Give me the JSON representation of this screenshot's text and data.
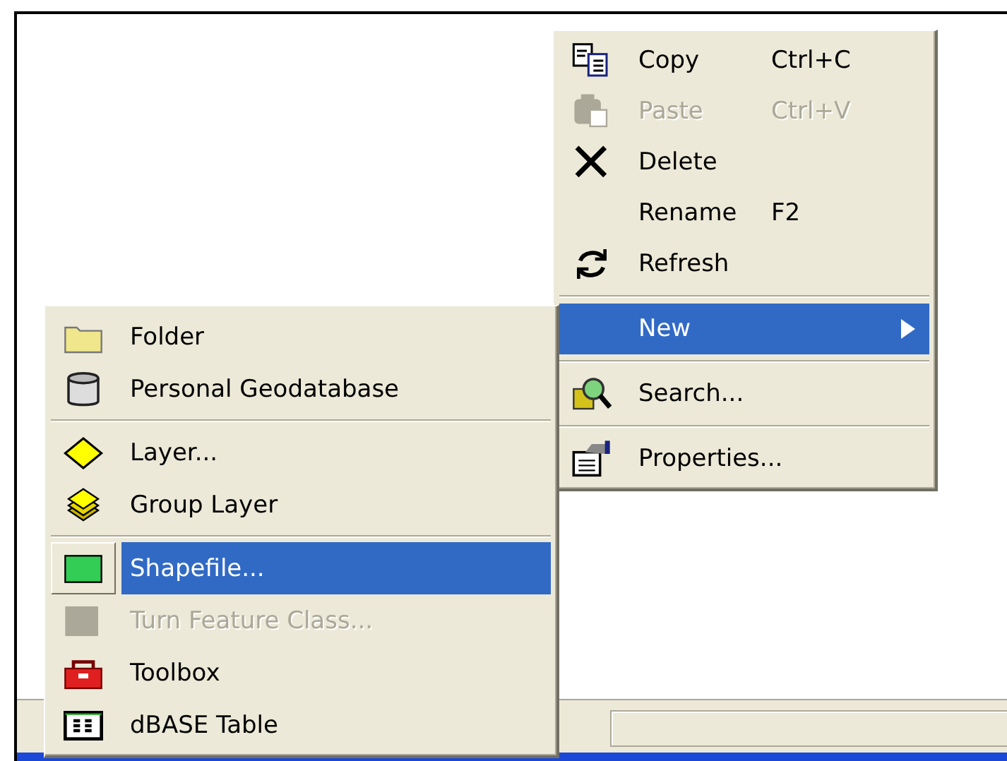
{
  "context_menu": {
    "items": [
      {
        "kind": "item",
        "label": "Copy",
        "shortcut": "Ctrl+C",
        "disabled": false,
        "selected": false,
        "has_submenu": false
      },
      {
        "kind": "item",
        "label": "Paste",
        "shortcut": "Ctrl+V",
        "disabled": true,
        "selected": false,
        "has_submenu": false
      },
      {
        "kind": "item",
        "label": "Delete",
        "disabled": false,
        "selected": false,
        "has_submenu": false
      },
      {
        "kind": "item",
        "label": "Rename",
        "shortcut": "F2",
        "disabled": false,
        "selected": false,
        "has_submenu": false
      },
      {
        "kind": "item",
        "label": "Refresh",
        "disabled": false,
        "selected": false,
        "has_submenu": false
      },
      {
        "kind": "separator"
      },
      {
        "kind": "item",
        "label": "New",
        "disabled": false,
        "selected": true,
        "has_submenu": true
      },
      {
        "kind": "separator"
      },
      {
        "kind": "item",
        "label": "Search...",
        "disabled": false,
        "selected": false,
        "has_submenu": false
      },
      {
        "kind": "separator"
      },
      {
        "kind": "item",
        "label": "Properties...",
        "disabled": false,
        "selected": false,
        "has_submenu": false
      }
    ]
  },
  "submenu": {
    "items": [
      {
        "kind": "item",
        "label": "Folder",
        "disabled": false,
        "selected": false
      },
      {
        "kind": "item",
        "label": "Personal Geodatabase",
        "disabled": false,
        "selected": false
      },
      {
        "kind": "separator"
      },
      {
        "kind": "item",
        "label": "Layer...",
        "disabled": false,
        "selected": false
      },
      {
        "kind": "item",
        "label": "Group Layer",
        "disabled": false,
        "selected": false
      },
      {
        "kind": "separator"
      },
      {
        "kind": "item",
        "label": "Shapefile...",
        "disabled": false,
        "selected": true
      },
      {
        "kind": "item",
        "label": "Turn Feature Class...",
        "disabled": true,
        "selected": false
      },
      {
        "kind": "item",
        "label": "Toolbox",
        "disabled": false,
        "selected": false
      },
      {
        "kind": "item",
        "label": "dBASE Table",
        "disabled": false,
        "selected": false
      }
    ]
  }
}
